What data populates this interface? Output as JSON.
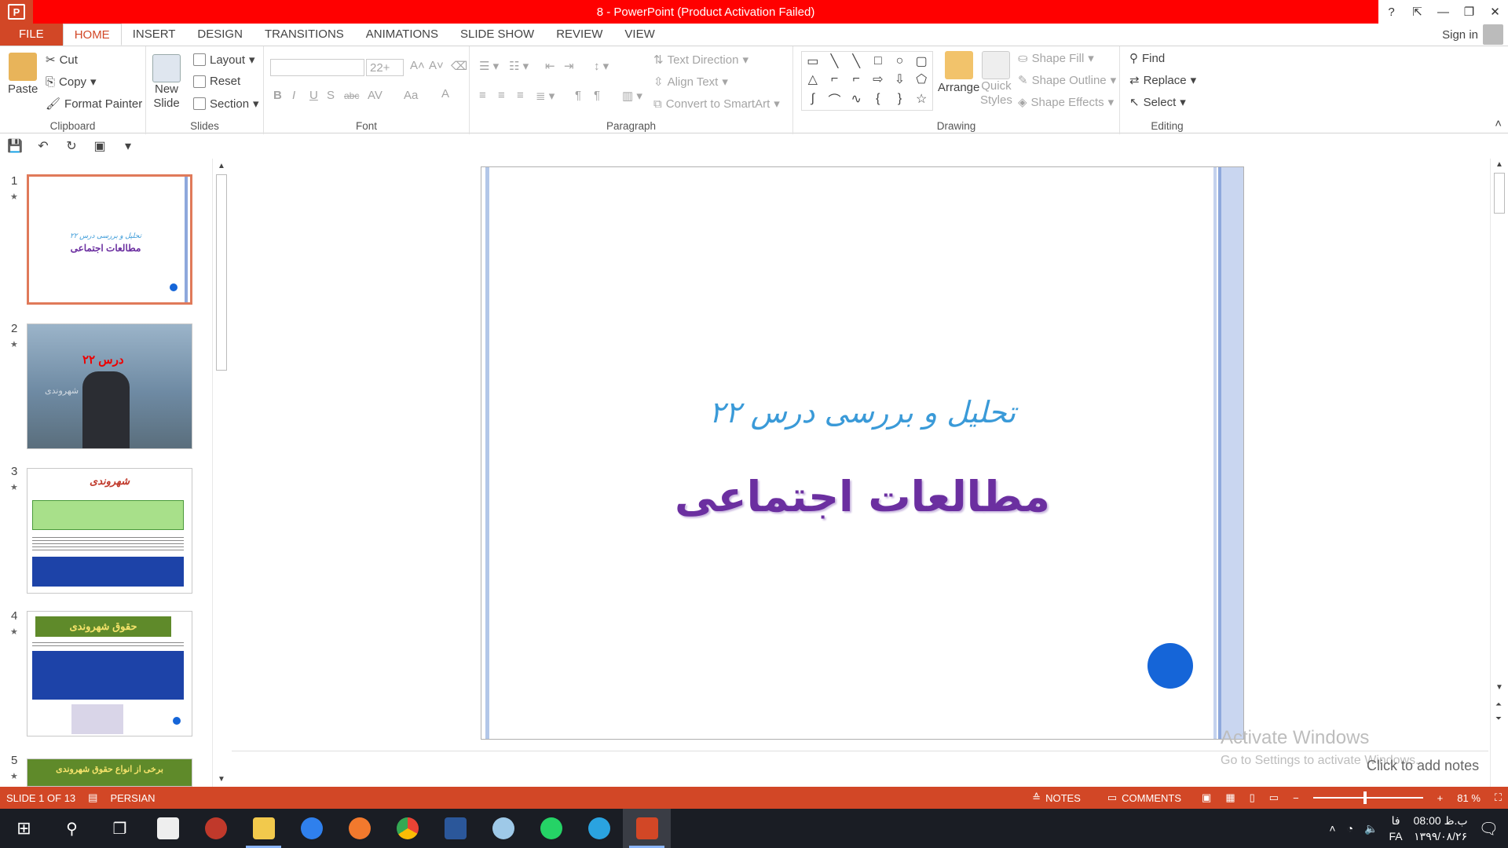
{
  "window": {
    "title": "8 -  PowerPoint (Product Activation Failed)",
    "help": "?",
    "restore_ribbon": "⇱",
    "minimize": "—",
    "maximize": "❐",
    "close": "✕"
  },
  "tabs": {
    "file": "FILE",
    "home": "HOME",
    "insert": "INSERT",
    "design": "DESIGN",
    "transitions": "TRANSITIONS",
    "animations": "ANIMATIONS",
    "slideshow": "SLIDE SHOW",
    "review": "REVIEW",
    "view": "VIEW",
    "signin": "Sign in"
  },
  "ribbon": {
    "clipboard": {
      "label": "Clipboard",
      "paste": "Paste",
      "cut": "Cut",
      "copy": "Copy",
      "format_painter": "Format Painter"
    },
    "slides": {
      "label": "Slides",
      "new_slide": "New",
      "new_slide2": "Slide",
      "layout": "Layout",
      "reset": "Reset",
      "section": "Section"
    },
    "font": {
      "label": "Font",
      "size": "22+",
      "bold": "B",
      "italic": "I",
      "underline": "U",
      "shadow": "S",
      "strike": "abc",
      "spacing": "AV",
      "case": "Aa",
      "color": "A"
    },
    "paragraph": {
      "label": "Paragraph",
      "text_direction": "Text Direction",
      "align_text": "Align Text",
      "convert_smartart": "Convert to SmartArt"
    },
    "drawing": {
      "label": "Drawing",
      "arrange": "Arrange",
      "quick_styles": "Quick",
      "quick_styles2": "Styles",
      "shape_fill": "Shape Fill",
      "shape_outline": "Shape Outline",
      "shape_effects": "Shape Effects"
    },
    "editing": {
      "label": "Editing",
      "find": "Find",
      "replace": "Replace",
      "select": "Select"
    }
  },
  "thumbnails": [
    {
      "num": "1",
      "star": "★",
      "title": "مطالعات اجتماعی",
      "sub": "تحلیل و بررسی درس ۲۲"
    },
    {
      "num": "2",
      "star": "★",
      "title": "درس ۲۲",
      "sub": "شهروندی"
    },
    {
      "num": "3",
      "star": "★",
      "title": "شهروندی"
    },
    {
      "num": "4",
      "star": "★",
      "title": "حقوق شهروندی"
    },
    {
      "num": "5",
      "star": "★",
      "title": "برخی از انواع حقوق شهروندی"
    }
  ],
  "slide": {
    "subtitle": "تحلیل و بررسی درس ۲۲",
    "title": "مطالعات اجتماعی"
  },
  "notes_placeholder": "Click to add notes",
  "watermark": {
    "line1": "Activate Windows",
    "line2": "Go to Settings to activate Windows."
  },
  "status": {
    "slide_info": "SLIDE 1 OF 13",
    "language": "PERSIAN",
    "notes": "NOTES",
    "comments": "COMMENTS",
    "zoom": "81 %",
    "zoom_level": 0.46
  },
  "taskbar": {
    "lang": "FA",
    "time": "08:00 ب.ظ",
    "date": "۱۳۹۹/۰۸/۲۶",
    "ime": "فا"
  },
  "colors": {
    "accent": "#d24726",
    "title_red": "#ff0000",
    "slide_title": "#6b2fa0",
    "slide_subtitle": "#3a9ad8",
    "dot_blue": "#1565d8"
  }
}
